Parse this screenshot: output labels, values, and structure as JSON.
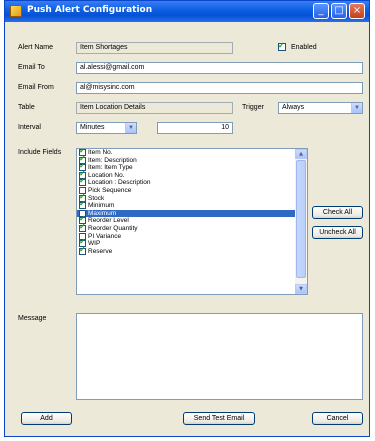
{
  "window": {
    "title": "Push Alert Configuration",
    "minimize": "_",
    "maximize": "□",
    "close": "×"
  },
  "form": {
    "alert_name_label": "Alert Name",
    "alert_name_value": "Item Shortages",
    "enabled_label": "Enabled",
    "enabled_checked": true,
    "email_to_label": "Email To",
    "email_to_value": "al.alessi@gmail.com",
    "email_from_label": "Email From",
    "email_from_value": "al@misysinc.com",
    "table_label": "Table",
    "table_value": "Item Location Details",
    "trigger_label": "Trigger",
    "trigger_value": "Always",
    "interval_label": "Interval",
    "interval_unit": "Minutes",
    "interval_value": "10",
    "include_fields_label": "Include Fields",
    "message_label": "Message"
  },
  "include_fields": [
    {
      "label": "Item No.",
      "checked": true,
      "selected": false
    },
    {
      "label": "Item: Description",
      "checked": true,
      "selected": false
    },
    {
      "label": "Item: Item Type",
      "checked": true,
      "selected": false
    },
    {
      "label": "Location No.",
      "checked": true,
      "selected": false
    },
    {
      "label": "Location : Description",
      "checked": true,
      "selected": false
    },
    {
      "label": "Pick Sequence",
      "checked": false,
      "selected": false
    },
    {
      "label": "Stock",
      "checked": true,
      "selected": false
    },
    {
      "label": "Minimum",
      "checked": true,
      "selected": false
    },
    {
      "label": "Maximum",
      "checked": false,
      "selected": true
    },
    {
      "label": "Reorder Level",
      "checked": true,
      "selected": false
    },
    {
      "label": "Reorder Quantity",
      "checked": true,
      "selected": false
    },
    {
      "label": "PI Variance",
      "checked": false,
      "selected": false
    },
    {
      "label": "WIP",
      "checked": true,
      "selected": false
    },
    {
      "label": "Reserve",
      "checked": true,
      "selected": false
    }
  ],
  "buttons": {
    "check_all": "Check All",
    "uncheck_all": "Uncheck All",
    "add": "Add",
    "send_test_email": "Send Test Email",
    "cancel": "Cancel"
  },
  "colors": {
    "title_bar": "#0b5ee0",
    "dialog_bg": "#ece9d8",
    "selection": "#316ac5"
  }
}
